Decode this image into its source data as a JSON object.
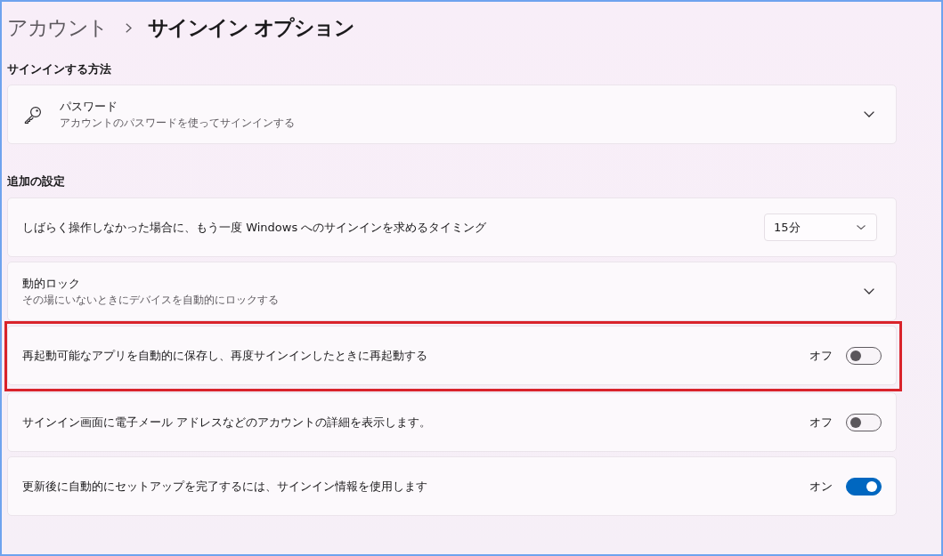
{
  "breadcrumb": {
    "parent": "アカウント",
    "current": "サインイン オプション"
  },
  "sections": [
    {
      "heading": "サインインする方法",
      "items": [
        {
          "kind": "method",
          "title": "パスワード",
          "subtitle": "アカウントのパスワードを使ってサインインする",
          "expanded": false,
          "highlighted": false
        }
      ]
    },
    {
      "heading": "追加の設定",
      "items": [
        {
          "kind": "dropdown",
          "title": "しばらく操作しなかった場合に、もう一度 Windows へのサインインを求めるタイミング",
          "value": "15分",
          "highlighted": false
        },
        {
          "kind": "expander",
          "title": "動的ロック",
          "subtitle": "その場にいないときにデバイスを自動的にロックする",
          "expanded": false,
          "highlighted": false
        },
        {
          "kind": "toggle",
          "title": "再起動可能なアプリを自動的に保存し、再度サインインしたときに再起動する",
          "state_label": "オフ",
          "on": false,
          "highlighted": true
        },
        {
          "kind": "toggle",
          "title": "サインイン画面に電子メール アドレスなどのアカウントの詳細を表示します。",
          "state_label": "オフ",
          "on": false,
          "highlighted": false
        },
        {
          "kind": "toggle",
          "title": "更新後に自動的にセットアップを完了するには、サインイン情報を使用します",
          "state_label": "オン",
          "on": true,
          "highlighted": false
        }
      ]
    }
  ]
}
